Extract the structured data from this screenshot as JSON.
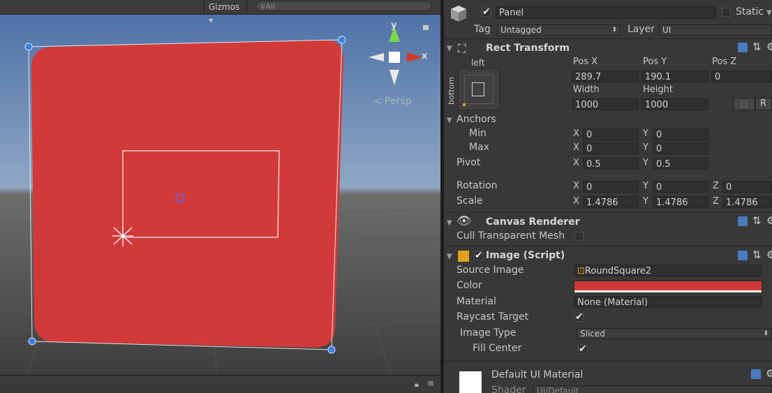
{
  "scene": {
    "gizmos_label": "Gizmos",
    "search_placeholder": "All",
    "persp_label": "< Persp",
    "axis_y": "y",
    "axis_x": "x",
    "colors": {
      "panel_red": "#d23a3a",
      "sky": "#5e7fb0",
      "ground": "#4a4a4a"
    }
  },
  "object": {
    "name": "Panel",
    "static_label": "Static",
    "tag_label": "Tag",
    "tag_value": "Untagged",
    "layer_label": "Layer",
    "layer_value": "UI"
  },
  "rect_transform": {
    "title": "Rect Transform",
    "anchor_left": "left",
    "anchor_bottom": "bottom",
    "pos_x_label": "Pos X",
    "pos_y_label": "Pos Y",
    "pos_z_label": "Pos Z",
    "pos_x": "289.7",
    "pos_y": "190.1",
    "pos_z": "0",
    "width_label": "Width",
    "height_label": "Height",
    "width": "1000",
    "height": "1000",
    "r_button": "R",
    "anchors_label": "Anchors",
    "min_label": "Min",
    "max_label": "Max",
    "pivot_label": "Pivot",
    "x_label": "X",
    "y_label": "Y",
    "z_label": "Z",
    "min_x": "0",
    "min_y": "0",
    "max_x": "0",
    "max_y": "0",
    "pivot_x": "0.5",
    "pivot_y": "0.5",
    "rotation_label": "Rotation",
    "rot_x": "0",
    "rot_y": "0",
    "rot_z": "0",
    "scale_label": "Scale",
    "scale_x": "1.4786",
    "scale_y": "1.4786",
    "scale_z": "1.4786"
  },
  "canvas_renderer": {
    "title": "Canvas Renderer",
    "cull_label": "Cull Transparent Mesh"
  },
  "image": {
    "title": "Image (Script)",
    "source_label": "Source Image",
    "source_value": "RoundSquare2",
    "color_label": "Color",
    "color_value": "#d23a3a",
    "material_label": "Material",
    "material_value": "None (Material)",
    "raycast_label": "Raycast Target",
    "image_type_label": "Image Type",
    "image_type_value": "Sliced",
    "fill_center_label": "Fill Center"
  },
  "material": {
    "name": "Default UI Material",
    "shader_label": "Shader",
    "shader_value": "UI/Default"
  }
}
